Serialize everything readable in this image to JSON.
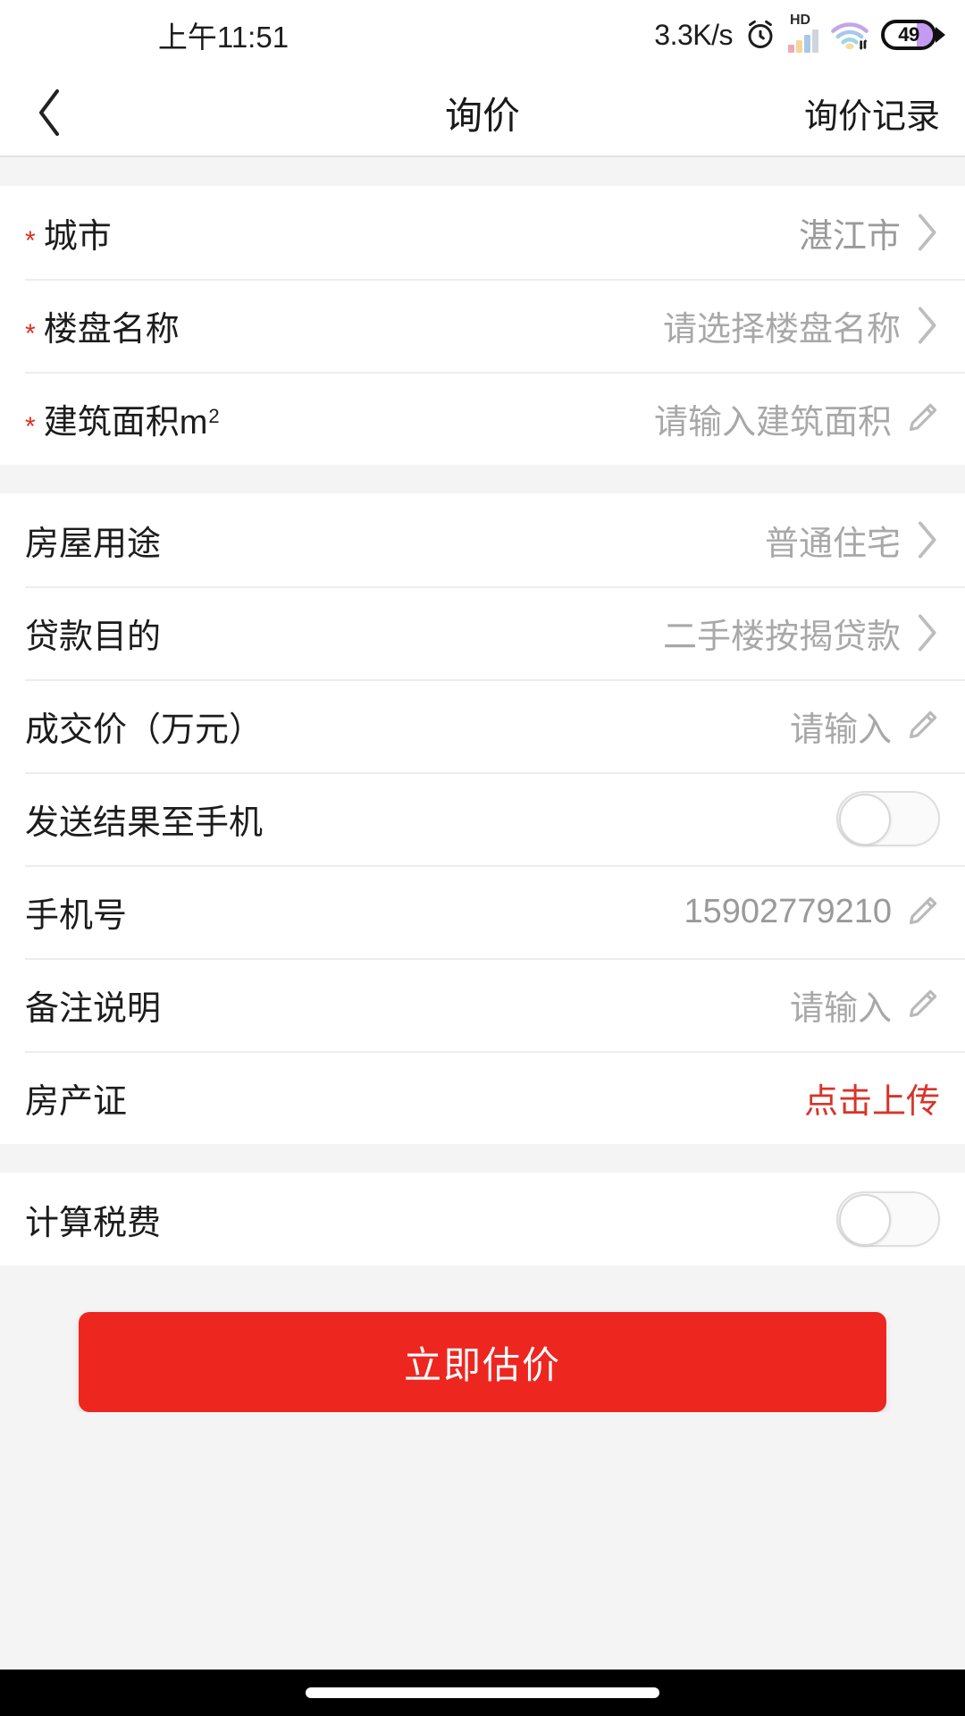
{
  "status_bar": {
    "time": "上午11:51",
    "net_speed": "3.3K/s",
    "alarm_icon": "alarm-clock-icon",
    "hd_label": "HD",
    "signal_icon": "signal-bars-icon",
    "wifi_icon": "wifi-icon",
    "battery_level": "49"
  },
  "nav": {
    "back_icon": "chevron-left-icon",
    "title": "询价",
    "action_label": "询价记录"
  },
  "colors": {
    "accent_red": "#ee2620",
    "upload_red": "#d7342a",
    "required_star": "#d93025",
    "page_bg": "#f4f4f4",
    "card_bg": "#ffffff",
    "label": "#1c1c1c",
    "placeholder": "#a8a8a8"
  },
  "sections": [
    {
      "name": "property-basics",
      "rows": [
        {
          "label": "城市",
          "required": true,
          "value": "湛江市",
          "placeholder": "",
          "control": "chevron",
          "filled": true
        },
        {
          "label": "楼盘名称",
          "required": true,
          "value": "请选择楼盘名称",
          "placeholder": "请选择楼盘名称",
          "control": "chevron",
          "filled": false
        },
        {
          "label": "建筑面积m",
          "label_sup": "2",
          "required": true,
          "value": "请输入建筑面积",
          "placeholder": "请输入建筑面积",
          "control": "pencil",
          "filled": false
        }
      ]
    },
    {
      "name": "loan-details",
      "rows": [
        {
          "label": "房屋用途",
          "required": false,
          "value": "普通住宅",
          "placeholder": "",
          "control": "chevron",
          "filled": false
        },
        {
          "label": "贷款目的",
          "required": false,
          "value": "二手楼按揭贷款",
          "placeholder": "",
          "control": "chevron",
          "filled": false
        },
        {
          "label": "成交价（万元）",
          "required": false,
          "value": "请输入",
          "placeholder": "请输入",
          "control": "pencil",
          "filled": false
        },
        {
          "label": "发送结果至手机",
          "required": false,
          "value": "",
          "control": "toggle",
          "toggle_on": false
        },
        {
          "label": "手机号",
          "required": false,
          "value": "15902779210",
          "placeholder": "",
          "control": "pencil",
          "filled": true
        },
        {
          "label": "备注说明",
          "required": false,
          "value": "请输入",
          "placeholder": "请输入",
          "control": "pencil",
          "filled": false
        },
        {
          "label": "房产证",
          "required": false,
          "value": "点击上传",
          "control": "upload",
          "filled": false
        }
      ]
    },
    {
      "name": "tax-calculation",
      "rows": [
        {
          "label": "计算税费",
          "required": false,
          "value": "",
          "control": "toggle",
          "toggle_on": false
        }
      ]
    }
  ],
  "submit": {
    "label": "立即估价"
  }
}
